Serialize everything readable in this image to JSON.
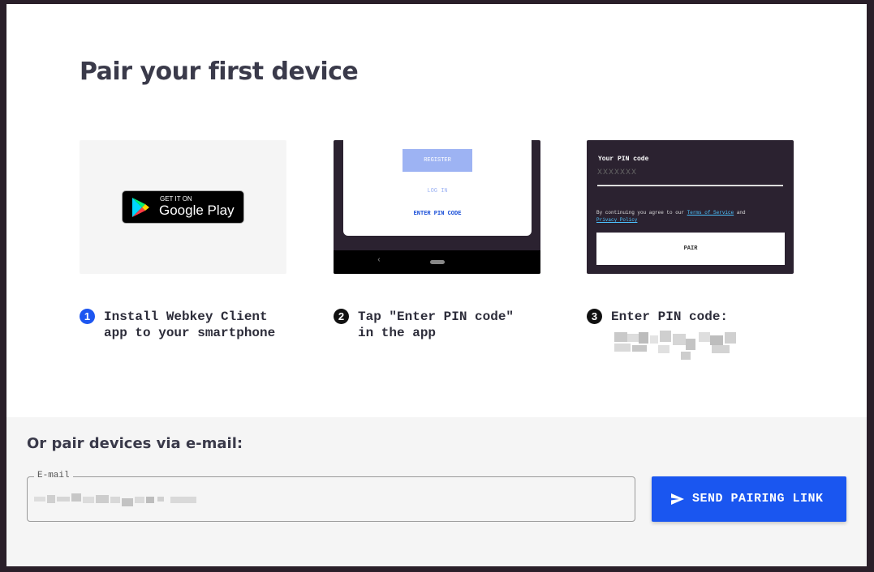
{
  "dialog": {
    "title": "Pair your first device",
    "cards": {
      "google_play": {
        "small": "GET IT ON",
        "big": "Google Play"
      },
      "phone": {
        "register": "REGISTER",
        "login": "LOG IN",
        "enter_pin": "ENTER PIN CODE"
      },
      "pin_screen": {
        "label": "Your PIN code",
        "placeholder": "XXXXXXX",
        "agree_prefix": "By continuing you agree to our ",
        "terms": "Terms of Service",
        "and": " and ",
        "privacy": "Privacy Policy",
        "pair": "PAIR"
      }
    },
    "steps": [
      {
        "number": "1",
        "text": "Install Webkey Client\napp to your smartphone"
      },
      {
        "number": "2",
        "text": "Tap \"Enter PIN code\"\nin the app"
      },
      {
        "number": "3",
        "text": "Enter PIN code:"
      }
    ],
    "email_section": {
      "title": "Or pair devices via e-mail:",
      "label": "E-mail",
      "send_button": "SEND PAIRING LINK"
    }
  },
  "colors": {
    "accent": "#1a56f0",
    "dark_card": "#2b2230",
    "link": "#4cc3ff"
  },
  "icons": {
    "play": "google-play-icon",
    "send": "send-icon"
  }
}
